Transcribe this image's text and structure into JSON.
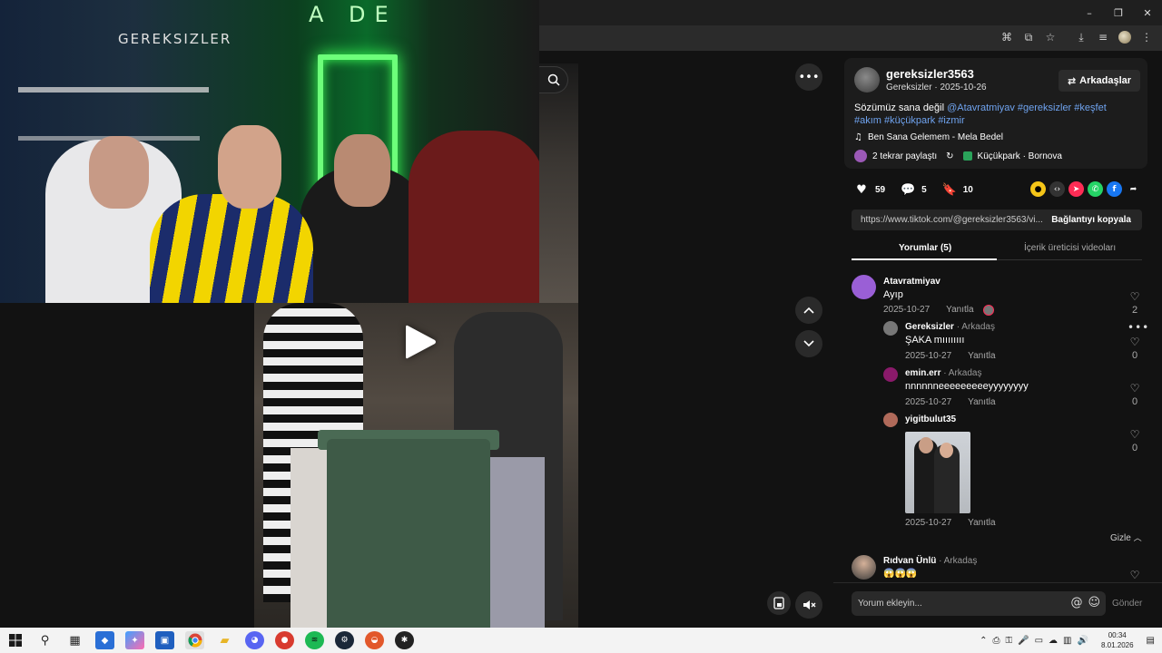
{
  "browser": {
    "window_controls": {
      "minimize": "–",
      "restore": "❐",
      "close": "✕"
    },
    "toolbar_icons": [
      "translate-icon",
      "screen-cast-icon",
      "star-icon",
      "download-icon",
      "reading-list-icon",
      "profile-avatar",
      "more-vert-icon"
    ]
  },
  "webcam": {
    "sign_text": "GEREKSIZLER",
    "neon_text": "A DE"
  },
  "video": {
    "controls": {
      "more": "•••",
      "prev": "⌃",
      "next": "⌄"
    }
  },
  "post": {
    "author_username": "gereksizler3563",
    "author_display": "Gereksizler",
    "date": "2025-10-26",
    "friends_button": "Arkadaşlar",
    "caption_plain": "Sözümüz sana değil ",
    "caption_tags": "@Atavratmiyav #gereksizler #keşfet #akım #küçükpark #izmir",
    "music": "Ben Sana Gelemem - Mela Bedel",
    "reposts": "2 tekrar paylaştı",
    "location": "Küçükpark · Bornova",
    "likes": "59",
    "comments": "5",
    "saves": "10",
    "url": "https://www.tiktok.com/@gereksizler3563/vi...",
    "copy_link": "Bağlantıyı kopyala"
  },
  "tabs": {
    "comments": "Yorumlar (5)",
    "creator_videos": "İçerik üreticisi videoları"
  },
  "comments": [
    {
      "name": "Atavratmiyav",
      "text": "Ayıp",
      "date": "2025-10-27",
      "reply": "Yanıtla",
      "likes": "2"
    },
    {
      "name": "Gereksizler",
      "tag": " · Arkadaş",
      "text": "ŞAKA mıııııııı",
      "date": "2025-10-27",
      "reply": "Yanıtla",
      "likes": "0"
    },
    {
      "name": "emin.err",
      "tag": " · Arkadaş",
      "text": "nnnnnneeeeeeeeeyyyyyyyy",
      "date": "2025-10-27",
      "reply": "Yanıtla",
      "likes": "0"
    },
    {
      "name": "yigitbulut35",
      "date": "2025-10-27",
      "reply": "Yanıtla",
      "likes": "0"
    },
    {
      "name": "Rıdvan Ünlü",
      "tag": " · Arkadaş",
      "text": "😱😱😱"
    }
  ],
  "hide_label": "Gizle",
  "comment_input": {
    "placeholder": "Yorum ekleyin...",
    "send": "Gönder"
  },
  "taskbar": {
    "time": "00:34",
    "date": "8.01.2026"
  },
  "colors": {
    "hashtag": "#6fa3ef",
    "accent_like": "#fe2c55"
  }
}
